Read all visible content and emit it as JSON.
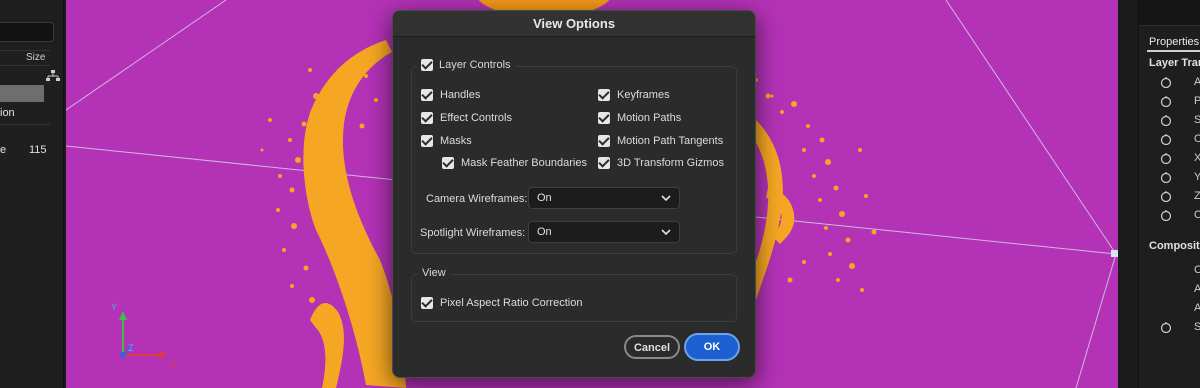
{
  "left_panel": {
    "size_header": "Size",
    "row_fragment_1": "ion",
    "row_fragment_2": "e",
    "row_value_2": "115"
  },
  "viewer": {
    "axis_y": "Y",
    "axis_z": "Z",
    "axis_x": "X",
    "colors": {
      "background": "#b332b6",
      "paint": "#f5a623"
    }
  },
  "right_panel": {
    "tab_label": "Properties:",
    "section_1": "Layer Trans",
    "section_2": "Compositing",
    "letters_1": [
      "A",
      "P",
      "S",
      "O",
      "X",
      "Y",
      "Z",
      "O"
    ],
    "letters_2": [
      "C",
      "A",
      "A",
      "S"
    ]
  },
  "dialog": {
    "title": "View Options",
    "layer_controls": {
      "label": "Layer Controls",
      "checked": true,
      "left_options": [
        {
          "label": "Handles",
          "checked": true
        },
        {
          "label": "Effect Controls",
          "checked": true
        },
        {
          "label": "Masks",
          "checked": true
        },
        {
          "label": "Mask Feather Boundaries",
          "checked": true
        }
      ],
      "right_options": [
        {
          "label": "Keyframes",
          "checked": true
        },
        {
          "label": "Motion Paths",
          "checked": true
        },
        {
          "label": "Motion Path Tangents",
          "checked": true
        },
        {
          "label": "3D Transform Gizmos",
          "checked": true
        }
      ],
      "camera_wireframes": {
        "label": "Camera Wireframes:",
        "value": "On"
      },
      "spotlight_wireframes": {
        "label": "Spotlight Wireframes:",
        "value": "On"
      }
    },
    "view": {
      "label": "View",
      "pixel_aspect": {
        "label": "Pixel Aspect Ratio Correction",
        "checked": true
      }
    },
    "buttons": {
      "cancel": "Cancel",
      "ok": "OK"
    }
  }
}
